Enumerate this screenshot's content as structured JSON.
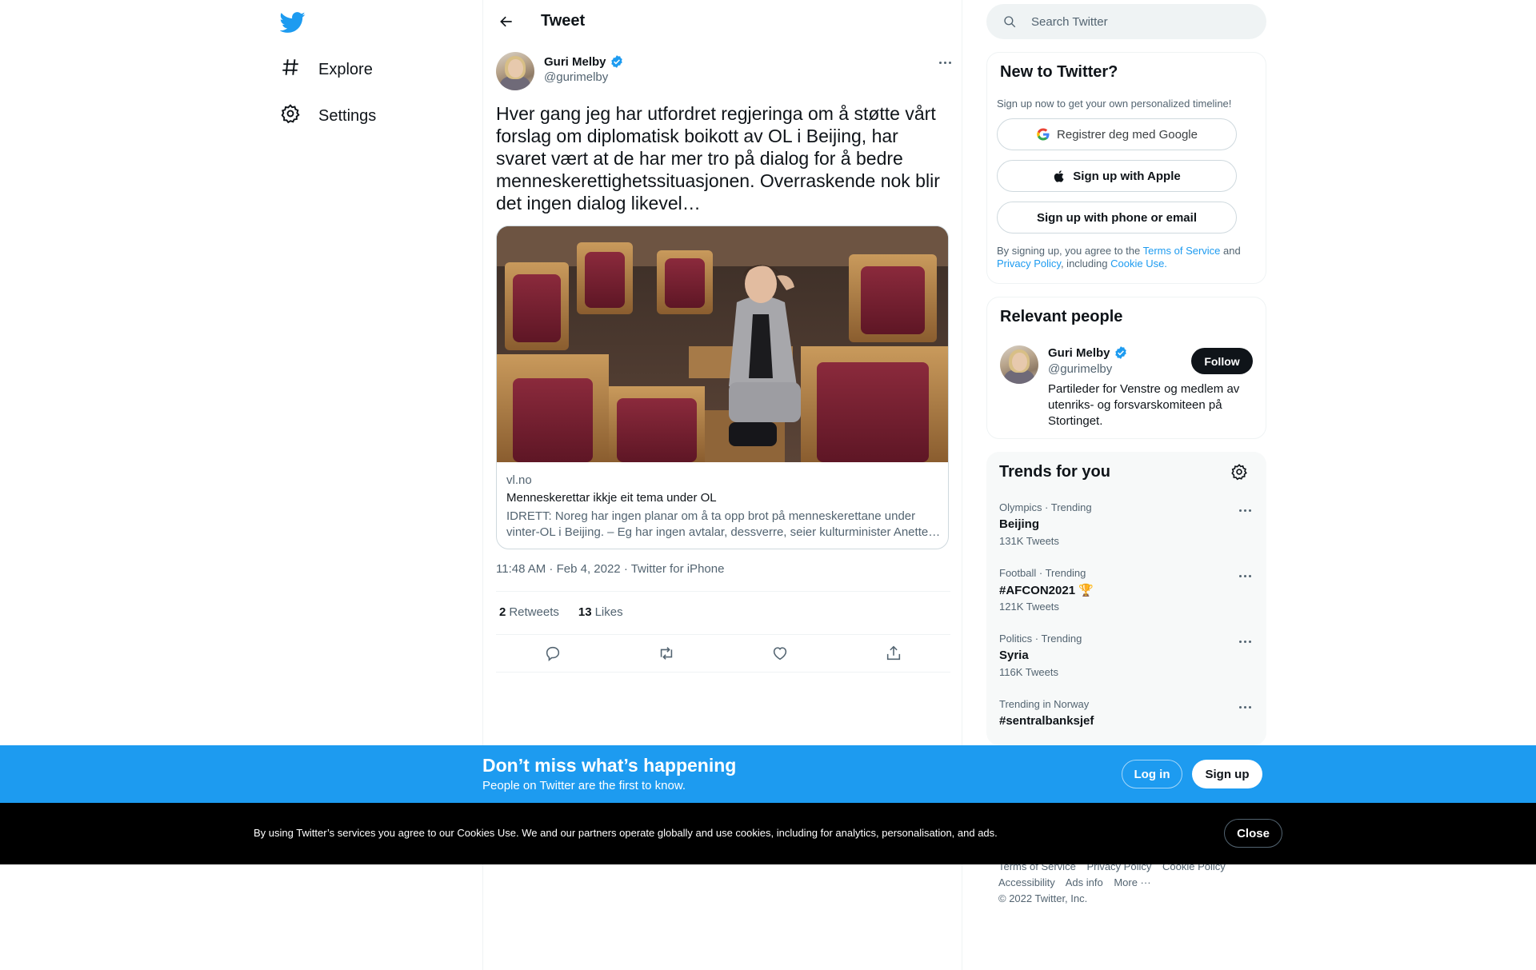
{
  "nav": {
    "logo_icon": "twitter-bird-icon",
    "items": [
      {
        "label": "Explore",
        "icon": "hashtag-icon"
      },
      {
        "label": "Settings",
        "icon": "gear-icon"
      }
    ]
  },
  "header": {
    "title": "Tweet",
    "back_icon": "arrow-left-icon"
  },
  "tweet": {
    "author_name": "Guri Melby",
    "author_handle": "@gurimelby",
    "text": "Hver gang jeg har utfordret regjeringa om å støtte vårt forslag om diplomatisk boikott av OL i Beijing, har svaret vært at de har mer tro på dialog for å bedre menneskerettighetssituasjonen. Overraskende nok blir det ingen dialog likevel…",
    "card": {
      "domain": "vl.no",
      "title": "Menneskerettar ikkje eit tema under OL",
      "description": "IDRETT: Noreg har ingen planar om å ta opp brot på menneskerettane under vinter-OL i Beijing. – Eg har ingen avtalar, dessverre, seier kulturminister Anette…"
    },
    "meta": "11:48 AM · Feb 4, 2022 · Twitter for iPhone",
    "retweets_count": "2",
    "retweets_label": "Retweets",
    "likes_count": "13",
    "likes_label": "Likes",
    "actions": [
      "reply-icon",
      "retweet-icon",
      "like-icon",
      "share-icon"
    ]
  },
  "search": {
    "placeholder": "Search Twitter"
  },
  "signup_panel": {
    "title": "New to Twitter?",
    "subtitle": "Sign up now to get your own personalized timeline!",
    "google_label": "Registrer deg med Google",
    "apple_label": "Sign up with Apple",
    "phone_label": "Sign up with phone or email",
    "terms_prefix": "By signing up, you agree to the ",
    "terms_link": "Terms of Service",
    "terms_and": " and ",
    "privacy_link": "Privacy Policy",
    "terms_including": ", including ",
    "cookie_link": "Cookie Use."
  },
  "relevant_people": {
    "title": "Relevant people",
    "name": "Guri Melby",
    "handle": "@gurimelby",
    "follow_label": "Follow",
    "bio": "Partileder for Venstre og medlem av utenriks- og forsvarskomiteen på Stortinget."
  },
  "trends": {
    "title": "Trends for you",
    "items": [
      {
        "context": "Olympics · Trending",
        "name": "Beijing",
        "count": "131K Tweets"
      },
      {
        "context": "Football · Trending",
        "name": "#AFCON2021 🏆",
        "count": "121K Tweets"
      },
      {
        "context": "Politics · Trending",
        "name": "Syria",
        "count": "116K Tweets"
      },
      {
        "context": "Trending in Norway",
        "name": "#sentralbanksjef",
        "count": ""
      }
    ]
  },
  "footer": {
    "links": [
      "Terms of Service",
      "Privacy Policy",
      "Cookie Policy",
      "Accessibility",
      "Ads info",
      "More ···"
    ],
    "copyright": "© 2022 Twitter, Inc."
  },
  "banner": {
    "title": "Don’t miss what’s happening",
    "subtitle": "People on Twitter are the first to know.",
    "login_label": "Log in",
    "signup_label": "Sign up"
  },
  "cookie_banner": {
    "text": "By using Twitter’s services you agree to our Cookies Use. We and our partners operate globally and use cookies, including for analytics, personalisation, and ads.",
    "close_label": "Close"
  },
  "colors": {
    "accent": "#1d9bf0",
    "text": "#0f1419",
    "secondary_text": "#536471",
    "cookie_bg": "#000000"
  }
}
